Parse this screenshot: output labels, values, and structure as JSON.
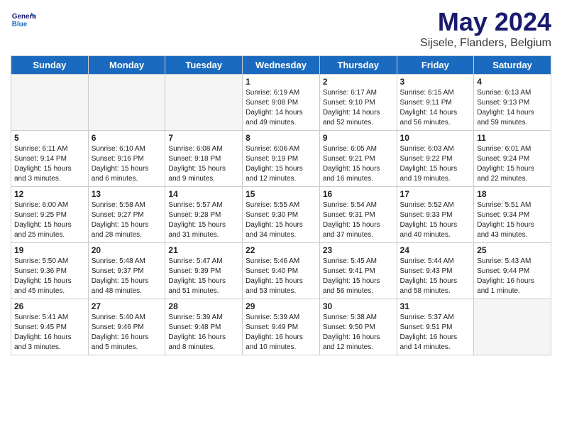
{
  "header": {
    "logo_line1": "General",
    "logo_line2": "Blue",
    "title": "May 2024",
    "location": "Sijsele, Flanders, Belgium"
  },
  "days_of_week": [
    "Sunday",
    "Monday",
    "Tuesday",
    "Wednesday",
    "Thursday",
    "Friday",
    "Saturday"
  ],
  "weeks": [
    [
      {
        "day": "",
        "data": ""
      },
      {
        "day": "",
        "data": ""
      },
      {
        "day": "",
        "data": ""
      },
      {
        "day": "1",
        "data": "Sunrise: 6:19 AM\nSunset: 9:08 PM\nDaylight: 14 hours and 49 minutes."
      },
      {
        "day": "2",
        "data": "Sunrise: 6:17 AM\nSunset: 9:10 PM\nDaylight: 14 hours and 52 minutes."
      },
      {
        "day": "3",
        "data": "Sunrise: 6:15 AM\nSunset: 9:11 PM\nDaylight: 14 hours and 56 minutes."
      },
      {
        "day": "4",
        "data": "Sunrise: 6:13 AM\nSunset: 9:13 PM\nDaylight: 14 hours and 59 minutes."
      }
    ],
    [
      {
        "day": "5",
        "data": "Sunrise: 6:11 AM\nSunset: 9:14 PM\nDaylight: 15 hours and 3 minutes."
      },
      {
        "day": "6",
        "data": "Sunrise: 6:10 AM\nSunset: 9:16 PM\nDaylight: 15 hours and 6 minutes."
      },
      {
        "day": "7",
        "data": "Sunrise: 6:08 AM\nSunset: 9:18 PM\nDaylight: 15 hours and 9 minutes."
      },
      {
        "day": "8",
        "data": "Sunrise: 6:06 AM\nSunset: 9:19 PM\nDaylight: 15 hours and 12 minutes."
      },
      {
        "day": "9",
        "data": "Sunrise: 6:05 AM\nSunset: 9:21 PM\nDaylight: 15 hours and 16 minutes."
      },
      {
        "day": "10",
        "data": "Sunrise: 6:03 AM\nSunset: 9:22 PM\nDaylight: 15 hours and 19 minutes."
      },
      {
        "day": "11",
        "data": "Sunrise: 6:01 AM\nSunset: 9:24 PM\nDaylight: 15 hours and 22 minutes."
      }
    ],
    [
      {
        "day": "12",
        "data": "Sunrise: 6:00 AM\nSunset: 9:25 PM\nDaylight: 15 hours and 25 minutes."
      },
      {
        "day": "13",
        "data": "Sunrise: 5:58 AM\nSunset: 9:27 PM\nDaylight: 15 hours and 28 minutes."
      },
      {
        "day": "14",
        "data": "Sunrise: 5:57 AM\nSunset: 9:28 PM\nDaylight: 15 hours and 31 minutes."
      },
      {
        "day": "15",
        "data": "Sunrise: 5:55 AM\nSunset: 9:30 PM\nDaylight: 15 hours and 34 minutes."
      },
      {
        "day": "16",
        "data": "Sunrise: 5:54 AM\nSunset: 9:31 PM\nDaylight: 15 hours and 37 minutes."
      },
      {
        "day": "17",
        "data": "Sunrise: 5:52 AM\nSunset: 9:33 PM\nDaylight: 15 hours and 40 minutes."
      },
      {
        "day": "18",
        "data": "Sunrise: 5:51 AM\nSunset: 9:34 PM\nDaylight: 15 hours and 43 minutes."
      }
    ],
    [
      {
        "day": "19",
        "data": "Sunrise: 5:50 AM\nSunset: 9:36 PM\nDaylight: 15 hours and 45 minutes."
      },
      {
        "day": "20",
        "data": "Sunrise: 5:48 AM\nSunset: 9:37 PM\nDaylight: 15 hours and 48 minutes."
      },
      {
        "day": "21",
        "data": "Sunrise: 5:47 AM\nSunset: 9:39 PM\nDaylight: 15 hours and 51 minutes."
      },
      {
        "day": "22",
        "data": "Sunrise: 5:46 AM\nSunset: 9:40 PM\nDaylight: 15 hours and 53 minutes."
      },
      {
        "day": "23",
        "data": "Sunrise: 5:45 AM\nSunset: 9:41 PM\nDaylight: 15 hours and 56 minutes."
      },
      {
        "day": "24",
        "data": "Sunrise: 5:44 AM\nSunset: 9:43 PM\nDaylight: 15 hours and 58 minutes."
      },
      {
        "day": "25",
        "data": "Sunrise: 5:43 AM\nSunset: 9:44 PM\nDaylight: 16 hours and 1 minute."
      }
    ],
    [
      {
        "day": "26",
        "data": "Sunrise: 5:41 AM\nSunset: 9:45 PM\nDaylight: 16 hours and 3 minutes."
      },
      {
        "day": "27",
        "data": "Sunrise: 5:40 AM\nSunset: 9:46 PM\nDaylight: 16 hours and 5 minutes."
      },
      {
        "day": "28",
        "data": "Sunrise: 5:39 AM\nSunset: 9:48 PM\nDaylight: 16 hours and 8 minutes."
      },
      {
        "day": "29",
        "data": "Sunrise: 5:39 AM\nSunset: 9:49 PM\nDaylight: 16 hours and 10 minutes."
      },
      {
        "day": "30",
        "data": "Sunrise: 5:38 AM\nSunset: 9:50 PM\nDaylight: 16 hours and 12 minutes."
      },
      {
        "day": "31",
        "data": "Sunrise: 5:37 AM\nSunset: 9:51 PM\nDaylight: 16 hours and 14 minutes."
      },
      {
        "day": "",
        "data": ""
      }
    ]
  ]
}
